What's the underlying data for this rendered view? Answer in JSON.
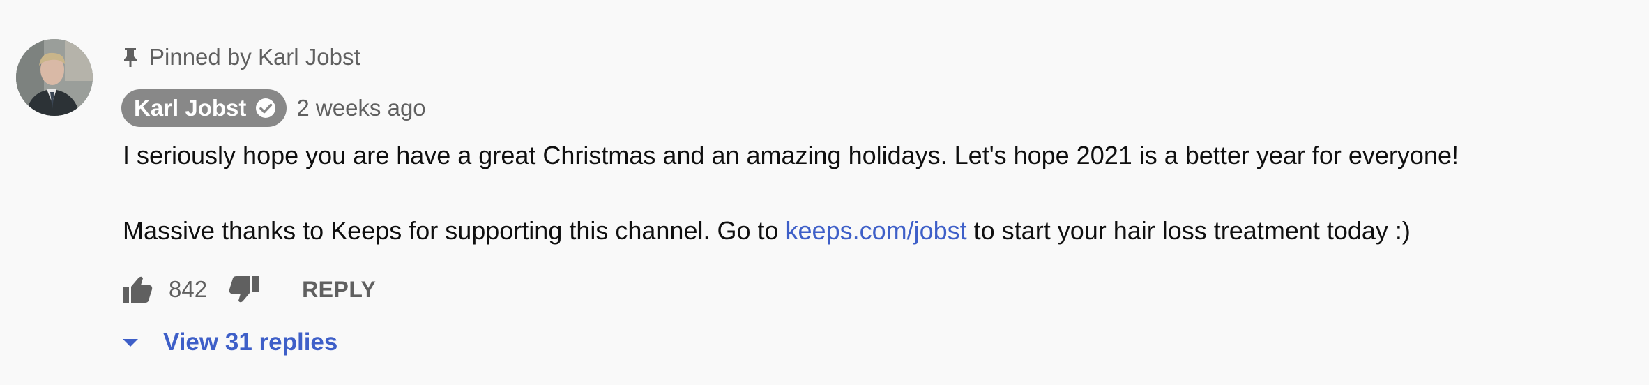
{
  "pinned": {
    "label": "Pinned by Karl Jobst",
    "icon": "pin-icon"
  },
  "author": {
    "name": "Karl Jobst",
    "verified": true,
    "badge_color": "#888888"
  },
  "timestamp": "2 weeks ago",
  "body": {
    "line1": "I seriously hope you are have a great Christmas and an amazing holidays. Let's hope 2021 is a better year for everyone!",
    "line2_prefix": "Massive thanks to Keeps for supporting this channel. Go to ",
    "line2_link": "keeps.com/jobst",
    "line2_suffix": " to start your hair loss treatment today :)",
    "link_color": "#3e5fc8"
  },
  "actions": {
    "like_count": "842",
    "reply_label": "REPLY",
    "like_icon": "thumbs-up-icon",
    "dislike_icon": "thumbs-down-icon"
  },
  "replies": {
    "label": "View 31 replies",
    "icon": "caret-down-icon"
  }
}
